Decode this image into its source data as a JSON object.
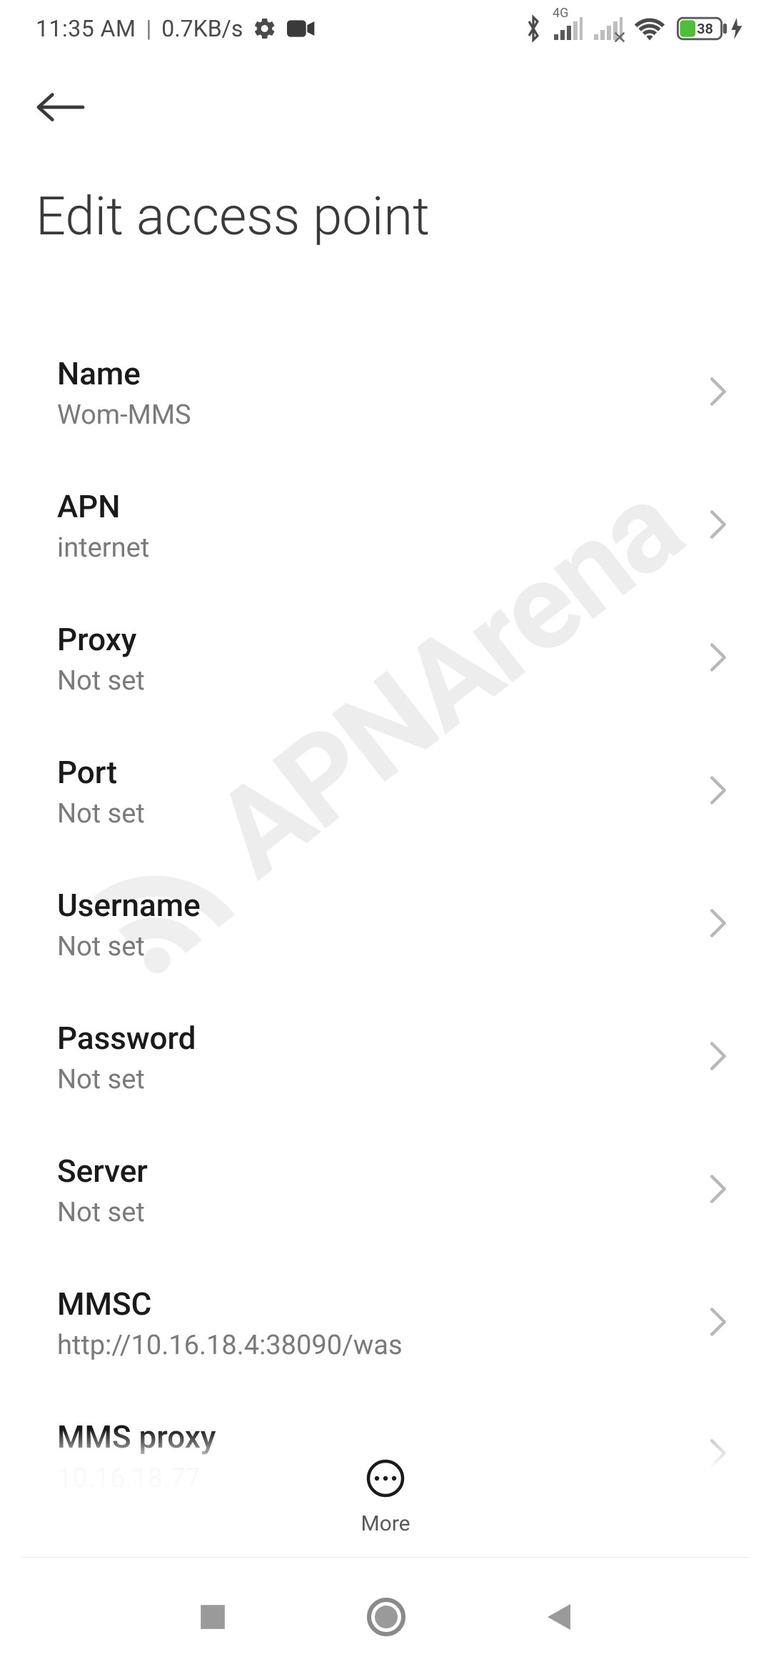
{
  "status_bar": {
    "time": "11:35 AM",
    "divider": "|",
    "net_speed": "0.7KB/s",
    "cell_label": "4G",
    "battery_percent": "38"
  },
  "header": {
    "title": "Edit access point"
  },
  "items": [
    {
      "label": "Name",
      "value": "Wom-MMS"
    },
    {
      "label": "APN",
      "value": "internet"
    },
    {
      "label": "Proxy",
      "value": "Not set"
    },
    {
      "label": "Port",
      "value": "Not set"
    },
    {
      "label": "Username",
      "value": "Not set"
    },
    {
      "label": "Password",
      "value": "Not set"
    },
    {
      "label": "Server",
      "value": "Not set"
    },
    {
      "label": "MMSC",
      "value": "http://10.16.18.4:38090/was"
    },
    {
      "label": "MMS proxy",
      "value": "10.16.18.77"
    }
  ],
  "bottom": {
    "more_label": "More"
  },
  "watermark": {
    "text": "APNArena"
  }
}
